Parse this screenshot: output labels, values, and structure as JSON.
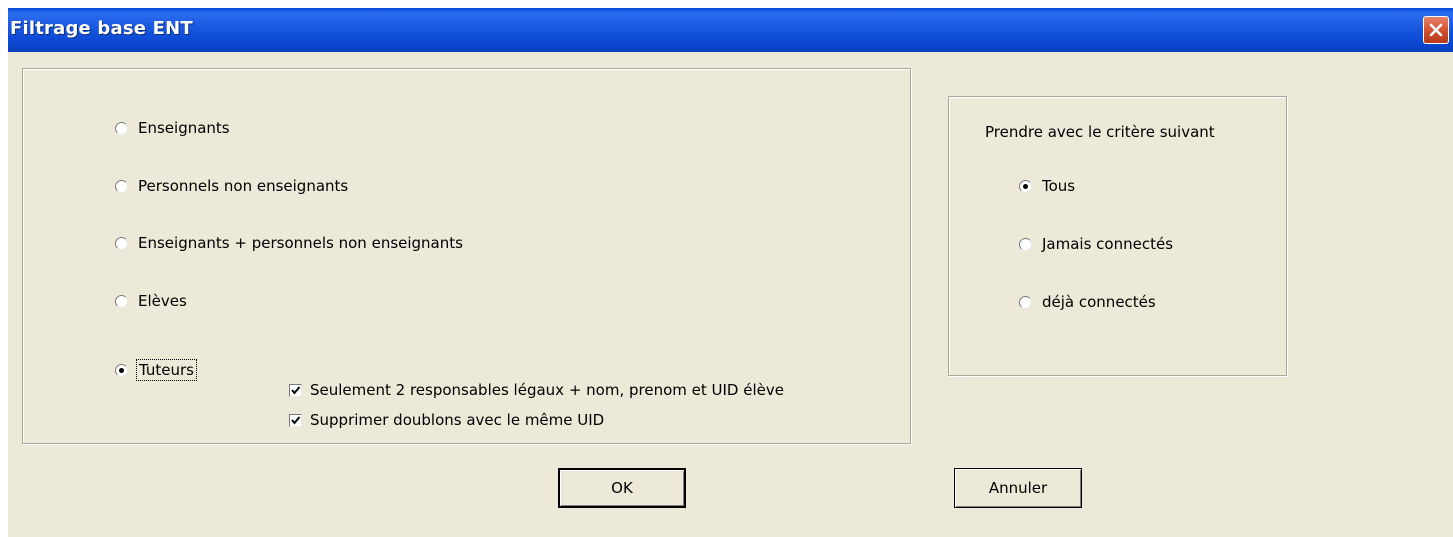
{
  "window": {
    "title": "Filtrage base ENT"
  },
  "population": {
    "options": [
      {
        "label": "Enseignants",
        "checked": false
      },
      {
        "label": "Personnels non enseignants",
        "checked": false
      },
      {
        "label": "Enseignants + personnels non enseignants",
        "checked": false
      },
      {
        "label": "Elèves",
        "checked": false
      },
      {
        "label": "Tuteurs",
        "checked": true
      }
    ],
    "tuteur_options": [
      {
        "label": "Seulement 2 responsables légaux + nom, prenom et UID élève",
        "checked": true
      },
      {
        "label": "Supprimer doublons avec le même UID",
        "checked": true
      }
    ]
  },
  "criteria": {
    "heading": "Prendre avec le critère suivant",
    "options": [
      {
        "label": "Tous",
        "checked": true
      },
      {
        "label": "Jamais connectés",
        "checked": false
      },
      {
        "label": "déjà connectés",
        "checked": false
      }
    ]
  },
  "buttons": {
    "ok_label": "OK",
    "cancel_label": "Annuler"
  }
}
